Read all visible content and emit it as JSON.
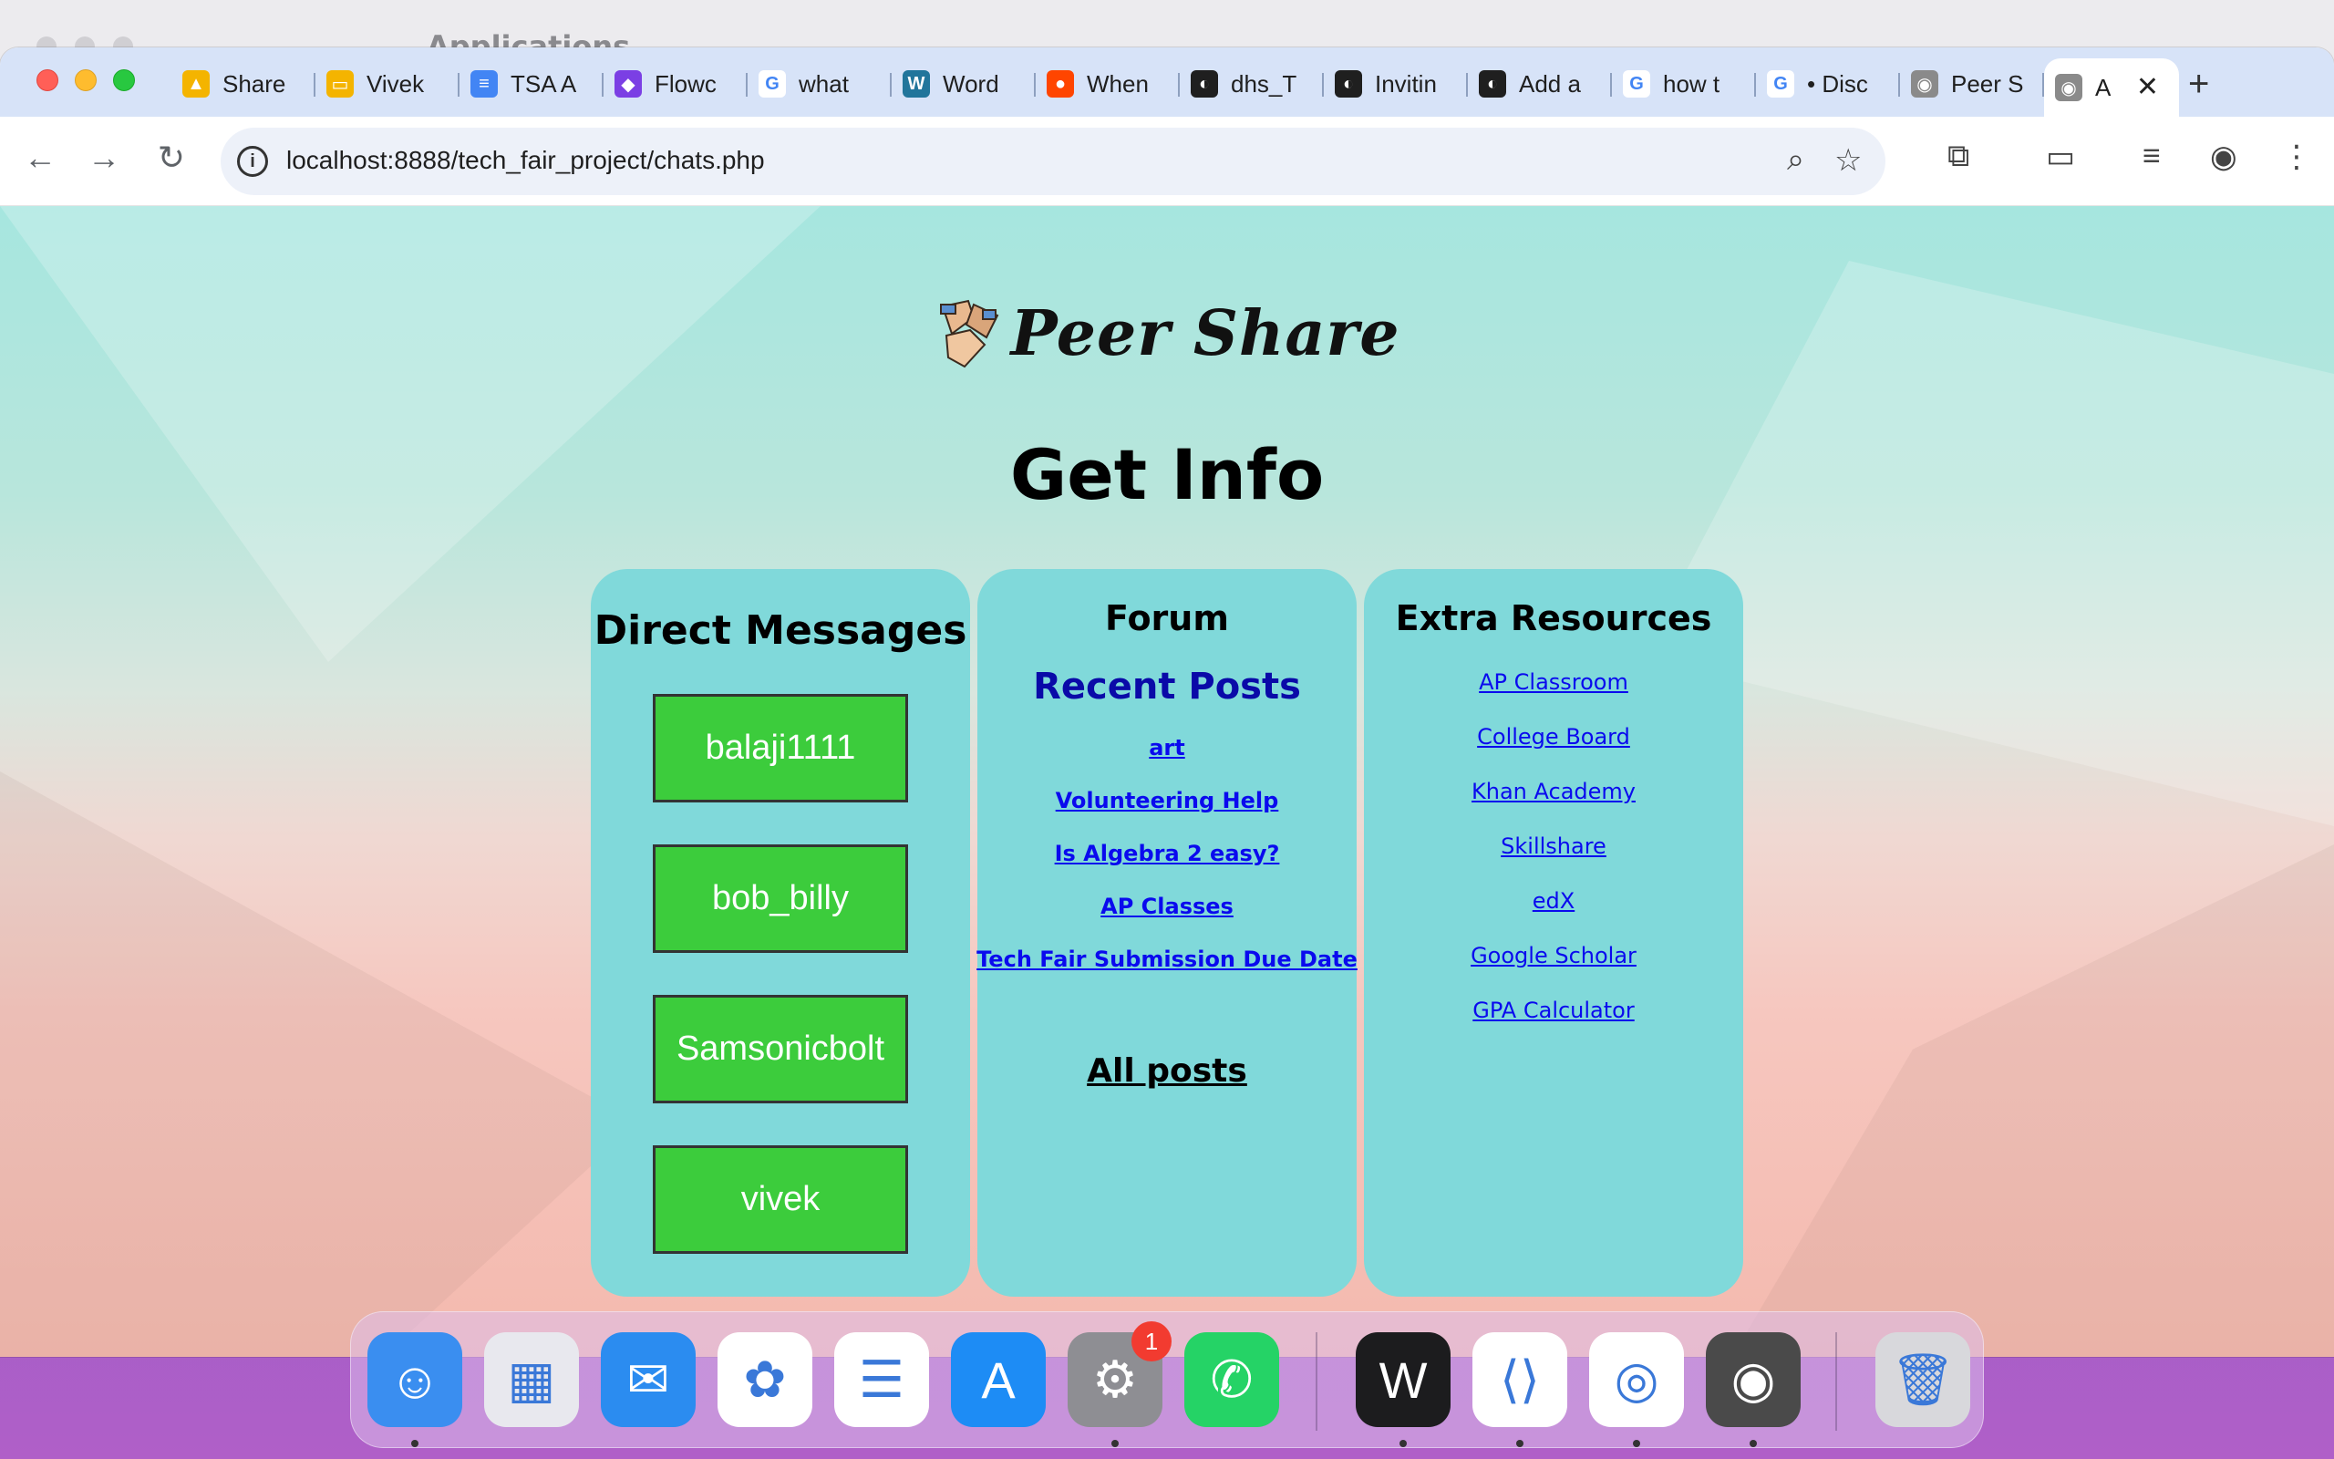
{
  "background_window": {
    "title": "Applications"
  },
  "browser": {
    "tabs": [
      {
        "label": "Share",
        "icon": "google-drive-icon",
        "color": "#f4b400"
      },
      {
        "label": "Vivek",
        "icon": "google-slides-icon",
        "color": "#f4b400"
      },
      {
        "label": "TSA A",
        "icon": "google-docs-icon",
        "color": "#4285f4"
      },
      {
        "label": "Flowc",
        "icon": "flowchart-app-icon",
        "color": "#7b3fe4"
      },
      {
        "label": "what",
        "icon": "google-icon",
        "color": "#ffffff"
      },
      {
        "label": "Word",
        "icon": "wordpress-icon",
        "color": "#21759b"
      },
      {
        "label": "When",
        "icon": "reddit-icon",
        "color": "#ff4500"
      },
      {
        "label": "dhs_T",
        "icon": "github-icon",
        "color": "#1f1f1f"
      },
      {
        "label": "Invitin",
        "icon": "github-icon",
        "color": "#1f1f1f"
      },
      {
        "label": "Add a",
        "icon": "github-icon",
        "color": "#1f1f1f"
      },
      {
        "label": "how t",
        "icon": "google-icon",
        "color": "#ffffff"
      },
      {
        "label": "• Disc",
        "icon": "google-icon",
        "color": "#ffffff"
      },
      {
        "label": "Peer S",
        "icon": "mamp-elephant-icon",
        "color": "#8a8a8a"
      }
    ],
    "active_tab": {
      "label": "A",
      "icon": "mamp-elephant-icon"
    },
    "address": "localhost:8888/tech_fair_project/chats.php"
  },
  "page": {
    "logo_text": "Peer Share",
    "heading": "Get Info",
    "direct_messages": {
      "title": "Direct Messages",
      "users": [
        "balaji1111",
        "bob_billy",
        "Samsonicbolt",
        "vivek"
      ]
    },
    "forum": {
      "title": "Forum",
      "subtitle": "Recent Posts",
      "posts": [
        "art",
        "Volunteering Help",
        "Is Algebra 2 easy?",
        "AP Classes",
        "Tech Fair Submission Due Date"
      ],
      "all_posts": "All posts"
    },
    "resources": {
      "title": "Extra Resources",
      "links": [
        "AP Classroom",
        "College Board",
        "Khan Academy",
        "Skillshare",
        "edX",
        "Google Scholar",
        "GPA Calculator"
      ]
    },
    "colors": {
      "panel": "#80d9da",
      "dm_button": "#3ccc3c",
      "link": "#0a0aee",
      "recent_posts": "#0a0aa8"
    }
  },
  "dock": {
    "apps": [
      {
        "name": "finder-icon",
        "color": "#3a8ef0",
        "running": true
      },
      {
        "name": "launchpad-icon",
        "color": "#e8e8ee",
        "running": false
      },
      {
        "name": "mail-icon",
        "color": "#2b8cf0",
        "running": false
      },
      {
        "name": "photos-icon",
        "color": "#ffffff",
        "running": false
      },
      {
        "name": "reminders-icon",
        "color": "#ffffff",
        "running": false
      },
      {
        "name": "app-store-icon",
        "color": "#1d8cf5",
        "running": false
      },
      {
        "name": "system-settings-icon",
        "color": "#8e8e93",
        "running": true,
        "badge": "1"
      },
      {
        "name": "whatsapp-icon",
        "color": "#25d366",
        "running": false
      },
      {
        "name": "webex-icon",
        "color": "#1c1c1e",
        "running": true
      },
      {
        "name": "vscode-icon",
        "color": "#ffffff",
        "running": true
      },
      {
        "name": "chrome-icon",
        "color": "#ffffff",
        "running": true
      },
      {
        "name": "mamp-icon",
        "color": "#4a4a4a",
        "running": true
      },
      {
        "name": "trash-icon",
        "color": "#d8d8dc",
        "running": false
      }
    ]
  }
}
